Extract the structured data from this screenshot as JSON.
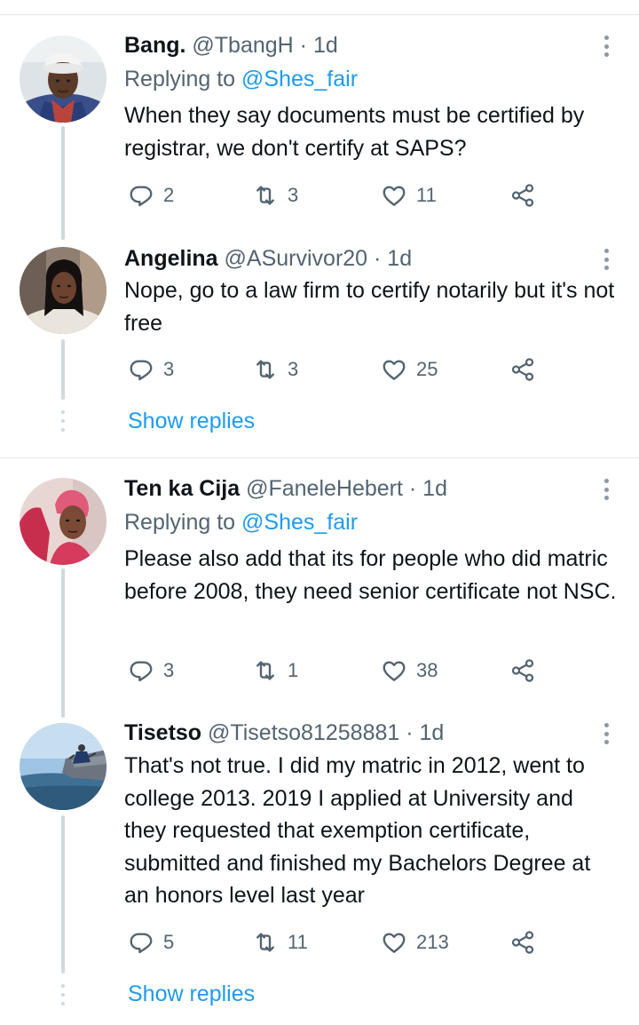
{
  "tweets": [
    {
      "name": "Bang.",
      "meta": "@TbangH · 1d",
      "replying_prefix": "Replying to ",
      "replying_handle": "@Shes_fair",
      "text": "When they say documents must be certified by registrar, we don't certify at SAPS?",
      "replies": "2",
      "retweets": "3",
      "likes": "11"
    },
    {
      "name": "Angelina",
      "meta": "@ASurvivor20 · 1d",
      "text": "Nope, go to a law firm to certify notarily but it's not free",
      "replies": "3",
      "retweets": "3",
      "likes": "25",
      "show_replies": "Show replies"
    },
    {
      "name": "Ten ka Cija",
      "meta": "@FaneleHebert · 1d",
      "replying_prefix": "Replying to ",
      "replying_handle": "@Shes_fair",
      "text": "Please also add that its for people who did matric before 2008,  they need senior certificate not NSC.",
      "replies": "3",
      "retweets": "1",
      "likes": "38"
    },
    {
      "name": "Tisetso",
      "meta": "@Tisetso81258881 · 1d",
      "text": "That's not true. I did my matric in 2012, went to college 2013. 2019 I applied at University and they requested that exemption certificate, submitted and finished my Bachelors Degree at an honors level last year",
      "replies": "5",
      "retweets": "11",
      "likes": "213",
      "show_replies": "Show replies"
    }
  ],
  "icons": {
    "reply": "reply-icon",
    "retweet": "retweet-icon",
    "like": "heart-icon",
    "share": "share-icon",
    "more": "more-icon"
  },
  "colors": {
    "link": "#1d9bf0",
    "secondary_text": "#536471",
    "thread_line": "#cfd9de"
  }
}
